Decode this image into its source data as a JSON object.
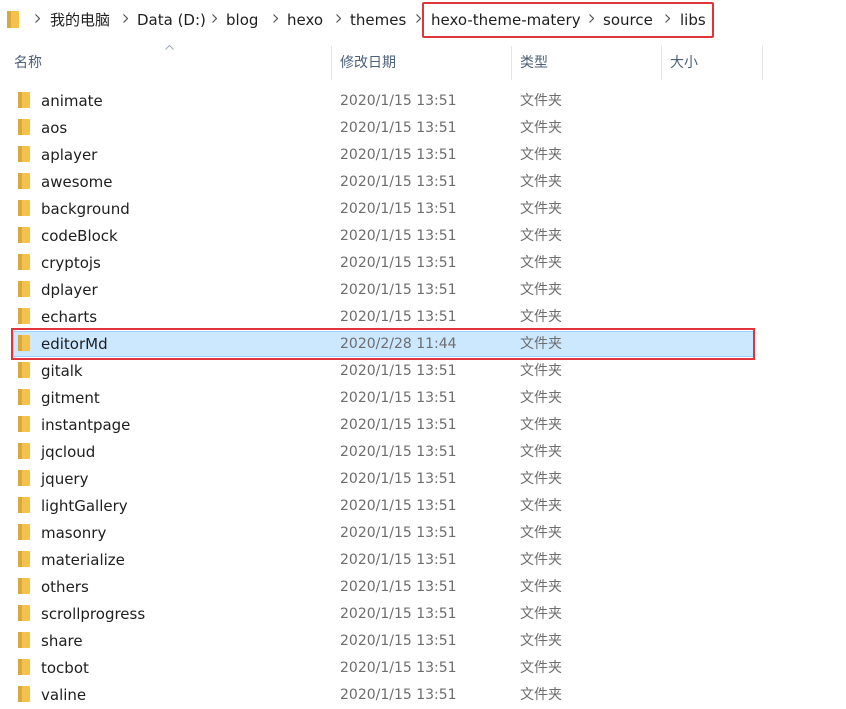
{
  "breadcrumb": [
    "我的电脑",
    "Data (D:)",
    "blog",
    "hexo",
    "themes",
    "hexo-theme-matery",
    "source",
    "libs"
  ],
  "columns": {
    "name": "名称",
    "modified": "修改日期",
    "type": "类型",
    "size": "大小"
  },
  "colors": {
    "folder": "#f2c14e",
    "folder_dark": "#dba93a",
    "selection": "#cce8ff",
    "annotation": "#e0343a"
  },
  "files": [
    {
      "name": "animate",
      "modified": "2020/1/15 13:51",
      "type": "文件夹",
      "icon": "folder-icon"
    },
    {
      "name": "aos",
      "modified": "2020/1/15 13:51",
      "type": "文件夹",
      "icon": "folder-icon"
    },
    {
      "name": "aplayer",
      "modified": "2020/1/15 13:51",
      "type": "文件夹",
      "icon": "folder-icon"
    },
    {
      "name": "awesome",
      "modified": "2020/1/15 13:51",
      "type": "文件夹",
      "icon": "folder-icon"
    },
    {
      "name": "background",
      "modified": "2020/1/15 13:51",
      "type": "文件夹",
      "icon": "folder-icon"
    },
    {
      "name": "codeBlock",
      "modified": "2020/1/15 13:51",
      "type": "文件夹",
      "icon": "folder-icon"
    },
    {
      "name": "cryptojs",
      "modified": "2020/1/15 13:51",
      "type": "文件夹",
      "icon": "folder-icon"
    },
    {
      "name": "dplayer",
      "modified": "2020/1/15 13:51",
      "type": "文件夹",
      "icon": "folder-icon"
    },
    {
      "name": "echarts",
      "modified": "2020/1/15 13:51",
      "type": "文件夹",
      "icon": "folder-icon"
    },
    {
      "name": "editorMd",
      "modified": "2020/2/28 11:44",
      "type": "文件夹",
      "icon": "folder-icon",
      "selected": true
    },
    {
      "name": "gitalk",
      "modified": "2020/1/15 13:51",
      "type": "文件夹",
      "icon": "folder-icon"
    },
    {
      "name": "gitment",
      "modified": "2020/1/15 13:51",
      "type": "文件夹",
      "icon": "folder-icon"
    },
    {
      "name": "instantpage",
      "modified": "2020/1/15 13:51",
      "type": "文件夹",
      "icon": "folder-icon"
    },
    {
      "name": "jqcloud",
      "modified": "2020/1/15 13:51",
      "type": "文件夹",
      "icon": "folder-icon"
    },
    {
      "name": "jquery",
      "modified": "2020/1/15 13:51",
      "type": "文件夹",
      "icon": "folder-icon"
    },
    {
      "name": "lightGallery",
      "modified": "2020/1/15 13:51",
      "type": "文件夹",
      "icon": "folder-icon"
    },
    {
      "name": "masonry",
      "modified": "2020/1/15 13:51",
      "type": "文件夹",
      "icon": "folder-icon"
    },
    {
      "name": "materialize",
      "modified": "2020/1/15 13:51",
      "type": "文件夹",
      "icon": "folder-icon"
    },
    {
      "name": "others",
      "modified": "2020/1/15 13:51",
      "type": "文件夹",
      "icon": "folder-icon"
    },
    {
      "name": "scrollprogress",
      "modified": "2020/1/15 13:51",
      "type": "文件夹",
      "icon": "folder-icon"
    },
    {
      "name": "share",
      "modified": "2020/1/15 13:51",
      "type": "文件夹",
      "icon": "folder-icon"
    },
    {
      "name": "tocbot",
      "modified": "2020/1/15 13:51",
      "type": "文件夹",
      "icon": "folder-icon"
    },
    {
      "name": "valine",
      "modified": "2020/1/15 13:51",
      "type": "文件夹",
      "icon": "folder-icon"
    }
  ]
}
